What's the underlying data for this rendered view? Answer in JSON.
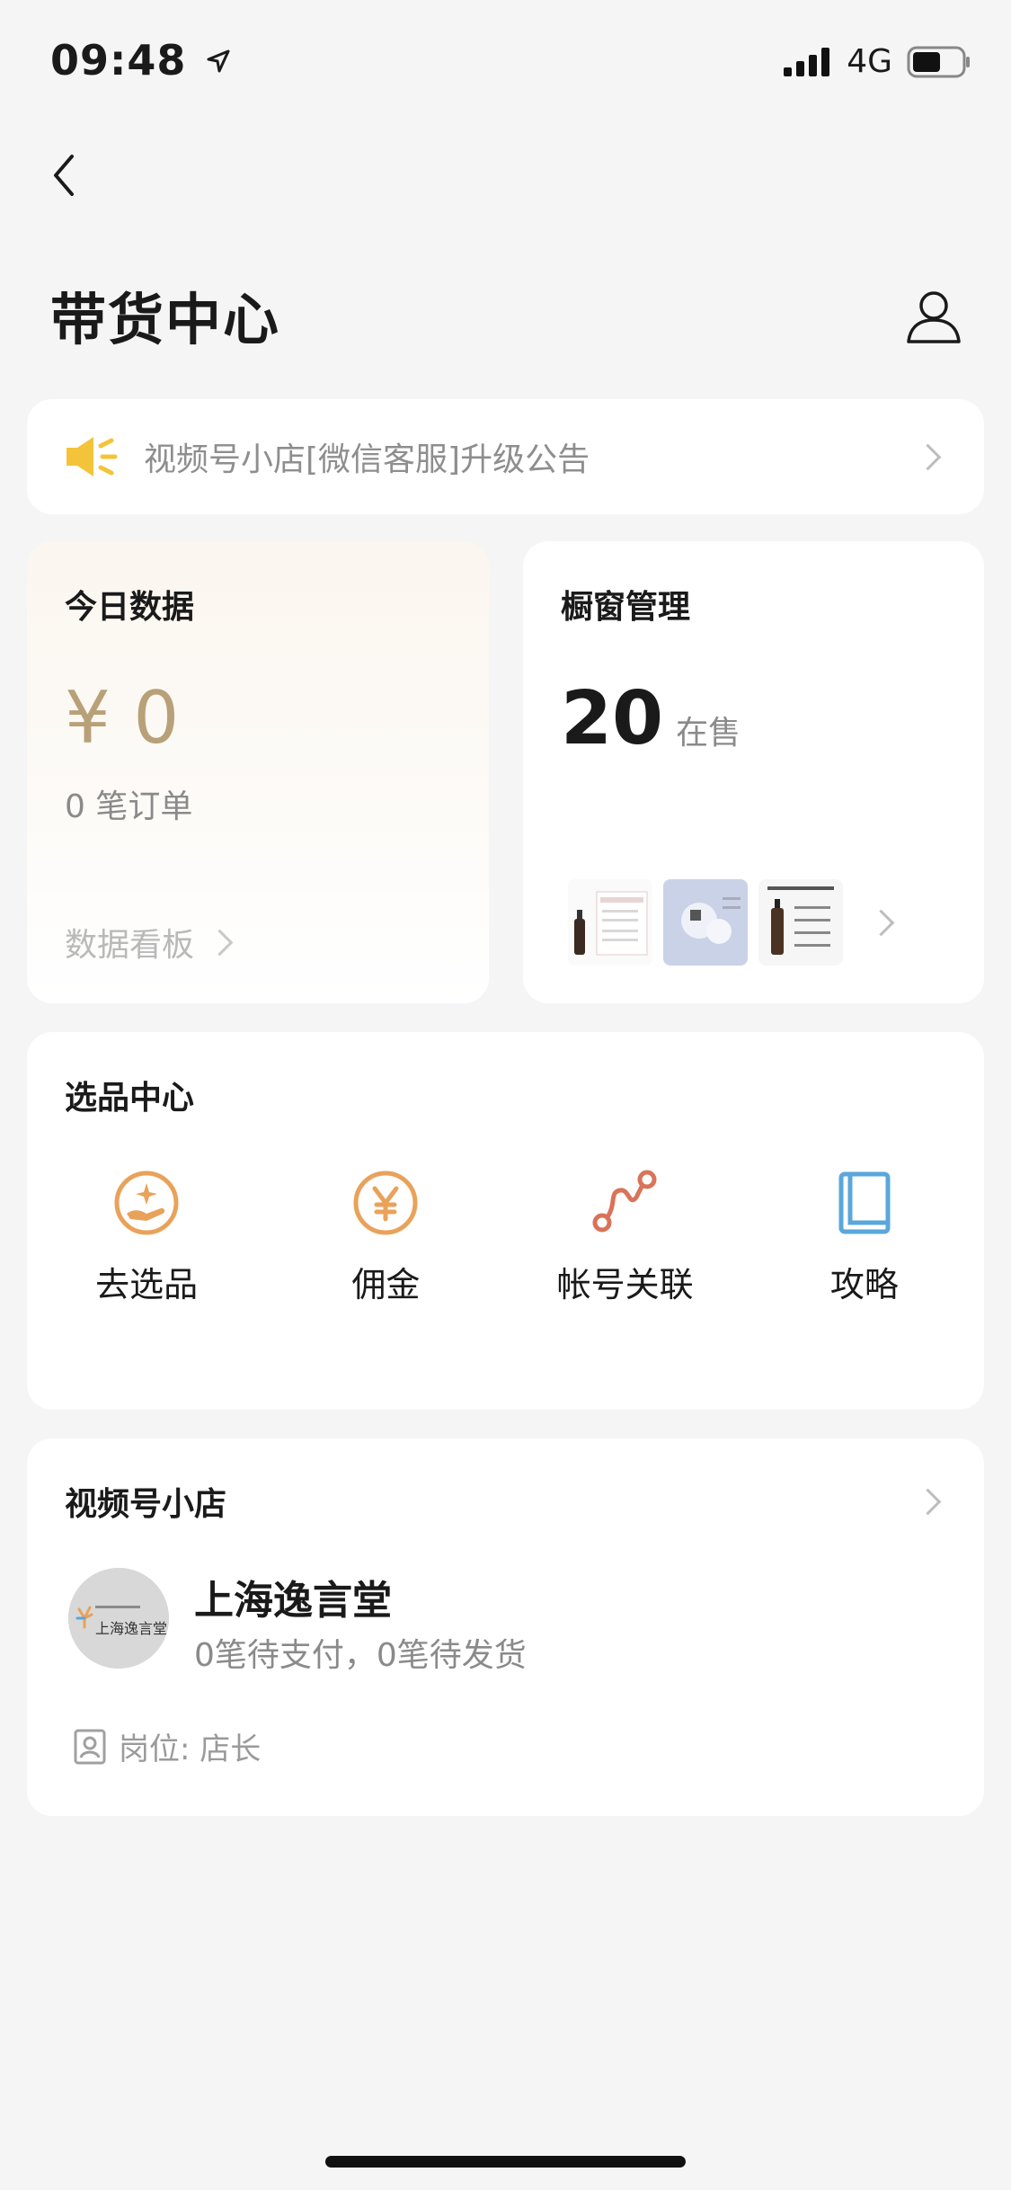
{
  "status_bar": {
    "time": "09:48",
    "network": "4G"
  },
  "header": {
    "title": "带货中心"
  },
  "notice": {
    "text": "视频号小店[微信客服]升级公告"
  },
  "today_data": {
    "title": "今日数据",
    "amount": "¥ 0",
    "orders": "0 笔订单",
    "dashboard_link": "数据看板"
  },
  "showcase": {
    "title": "橱窗管理",
    "count": "20",
    "count_unit": "在售"
  },
  "selection_center": {
    "title": "选品中心",
    "items": [
      {
        "label": "去选品",
        "icon": "hand-sparkle-icon"
      },
      {
        "label": "佣金",
        "icon": "yen-coin-icon"
      },
      {
        "label": "帐号关联",
        "icon": "link-nodes-icon"
      },
      {
        "label": "攻略",
        "icon": "book-icon"
      }
    ]
  },
  "shop": {
    "title": "视频号小店",
    "name": "上海逸言堂",
    "avatar_text": "上海逸言堂",
    "status": "0笔待支付，0笔待发货",
    "role": "岗位: 店长"
  },
  "colors": {
    "accent_gold": "#b8a078",
    "icon_orange": "#e9a25a",
    "icon_blue": "#5aa7dc",
    "notice_yellow": "#f3c43a"
  }
}
